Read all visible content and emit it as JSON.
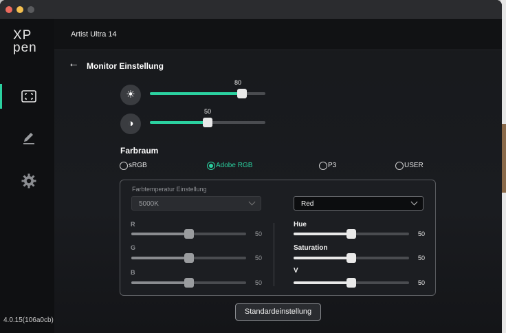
{
  "app": {
    "logo_top": "XP",
    "logo_bottom": "pen",
    "device_name": "Artist Ultra 14",
    "version": "4.0.15(106a0cb)"
  },
  "sidebar": {
    "items": [
      {
        "icon": "monitor-frame-icon",
        "active": true
      },
      {
        "icon": "pen-icon",
        "active": false
      },
      {
        "icon": "gear-icon",
        "active": false
      }
    ]
  },
  "page": {
    "back_icon": "←",
    "title": "Monitor Einstellung"
  },
  "brightness": {
    "icon": "☀",
    "value": 80,
    "max": 100,
    "value_label": "80"
  },
  "contrast": {
    "icon": "◑",
    "value": 50,
    "max": 100,
    "value_label": "50"
  },
  "colorspace": {
    "title": "Farbraum",
    "options": [
      {
        "label": "sRGB",
        "selected": false
      },
      {
        "label": "Adobe RGB",
        "selected": true
      },
      {
        "label": "P3",
        "selected": false
      },
      {
        "label": "USER",
        "selected": false
      }
    ]
  },
  "color_temp": {
    "title": "Farbtemperatur Einstellung",
    "temp_value": "5000K",
    "channel_value": "Red",
    "rgb": [
      {
        "label": "R",
        "value": 50,
        "value_label": "50"
      },
      {
        "label": "G",
        "value": 50,
        "value_label": "50"
      },
      {
        "label": "B",
        "value": 50,
        "value_label": "50"
      }
    ],
    "hsv": [
      {
        "label": "Hue",
        "value": 50,
        "value_label": "50"
      },
      {
        "label": "Saturation",
        "value": 50,
        "value_label": "50"
      },
      {
        "label": "V",
        "value": 50,
        "value_label": "50"
      }
    ]
  },
  "reset_label": "Standardeinstellung",
  "colors": {
    "accent": "#2bd1a0",
    "background": "#16181b",
    "sidebar": "#0f1012"
  }
}
